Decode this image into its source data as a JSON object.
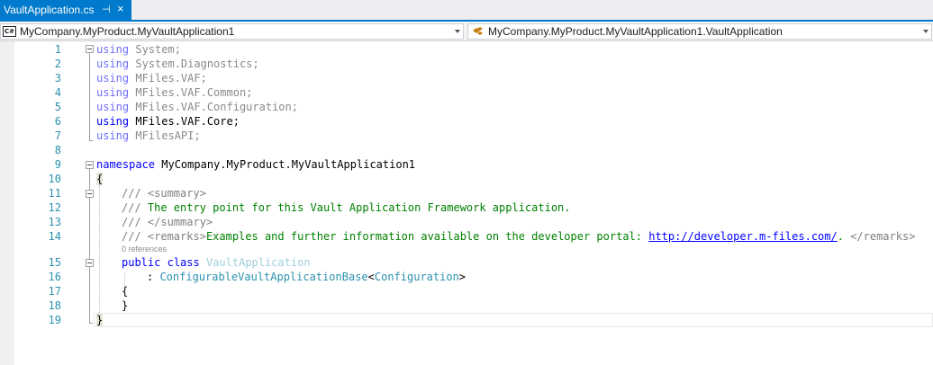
{
  "tab": {
    "title": "VaultApplication.cs",
    "pin_icon": "pin-icon",
    "close_icon": "close-icon"
  },
  "navbar": {
    "project_combo": "MyCompany.MyProduct.MyVaultApplication1",
    "type_combo": "MyCompany.MyProduct.MyVaultApplication1.VaultApplication"
  },
  "editor": {
    "line_numbers": [
      "1",
      "2",
      "3",
      "4",
      "5",
      "6",
      "7",
      "8",
      "9",
      "10",
      "11",
      "12",
      "13",
      "14",
      "15",
      "16",
      "17",
      "18",
      "19"
    ],
    "lines": {
      "l1": {
        "kw": "using",
        "rest": " System;"
      },
      "l2": {
        "kw": "using",
        "rest": " System.Diagnostics;"
      },
      "l3": {
        "kw": "using",
        "rest": " MFiles.VAF;"
      },
      "l4": {
        "kw": "using",
        "rest": " MFiles.VAF.Common;"
      },
      "l5": {
        "kw": "using",
        "rest": " MFiles.VAF.Configuration;"
      },
      "l6": {
        "kw": "using",
        "rest": " MFiles.VAF.Core;"
      },
      "l7": {
        "kw": "using",
        "rest": " MFilesAPI;"
      },
      "l9": {
        "kw": "namespace",
        "rest": " MyCompany.MyProduct.MyVaultApplication1"
      },
      "l10": {
        "text": "{"
      },
      "l11": {
        "slashes": "/// ",
        "tag": "<summary>"
      },
      "l12": {
        "slashes": "/// ",
        "text": "The entry point for this Vault Application Framework application."
      },
      "l13": {
        "slashes": "/// ",
        "tag": "</summary>"
      },
      "l14": {
        "slashes": "/// ",
        "tag_open": "<remarks>",
        "text": "Examples and further information available on the developer portal: ",
        "link": "http://developer.m-files.com/",
        "after": ". ",
        "tag_close": "</remarks>"
      },
      "codelens": "0 references",
      "l15": {
        "kw1": "public",
        "kw2": "class",
        "type": "VaultApplication"
      },
      "l16": {
        "colon": ": ",
        "base": "ConfigurableVaultApplicationBase",
        "lt": "<",
        "generic": "Configuration",
        "gt": ">"
      },
      "l17": {
        "text": "{"
      },
      "l18": {
        "text": "}"
      },
      "l19": {
        "text": "}"
      }
    }
  },
  "colors": {
    "accent": "#007acc",
    "keyword": "#0000ff",
    "type": "#2b91af",
    "comment": "#008000",
    "line_number": "#2b91af"
  }
}
